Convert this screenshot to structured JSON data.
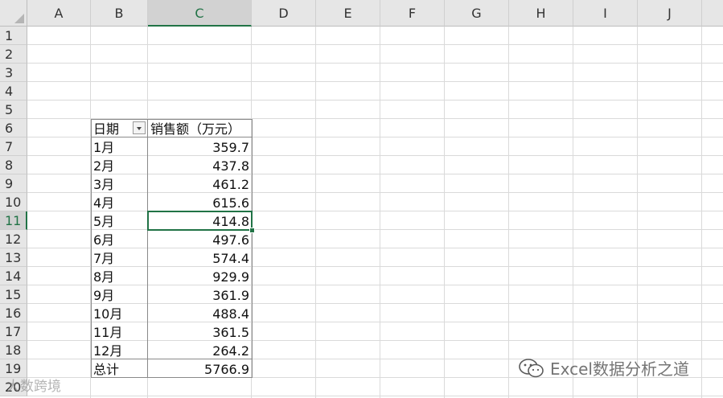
{
  "columns": [
    "A",
    "B",
    "C",
    "D",
    "E",
    "F",
    "G",
    "H",
    "I",
    "J"
  ],
  "selected_column": "C",
  "rows": [
    1,
    2,
    3,
    4,
    5,
    6,
    7,
    8,
    9,
    10,
    11,
    12,
    13,
    14,
    15,
    16,
    17,
    18,
    19,
    20
  ],
  "selected_row": 11,
  "pivot": {
    "header_date": "日期",
    "header_sales": "销售额（万元）",
    "rows": [
      {
        "month": "1月",
        "value": "359.7"
      },
      {
        "month": "2月",
        "value": "437.8"
      },
      {
        "month": "3月",
        "value": "461.2"
      },
      {
        "month": "4月",
        "value": "615.6"
      },
      {
        "month": "5月",
        "value": "414.8"
      },
      {
        "month": "6月",
        "value": "497.6"
      },
      {
        "month": "7月",
        "value": "574.4"
      },
      {
        "month": "8月",
        "value": "929.9"
      },
      {
        "month": "9月",
        "value": "361.9"
      },
      {
        "month": "10月",
        "value": "488.4"
      },
      {
        "month": "11月",
        "value": "361.5"
      },
      {
        "month": "12月",
        "value": "264.2"
      }
    ],
    "total_label": "总计",
    "total_value": "5766.9"
  },
  "active_cell": "C11",
  "icons": {
    "filter": "filter-dropdown-icon",
    "wechat": "wechat-icon",
    "corner": "select-all-icon"
  },
  "watermark": {
    "brand_text": "Excel数据分析之道",
    "left_text": "大数跨境"
  },
  "colors": {
    "accent": "#217346",
    "header_bg": "#e6e6e6",
    "gridline": "#dadada"
  }
}
